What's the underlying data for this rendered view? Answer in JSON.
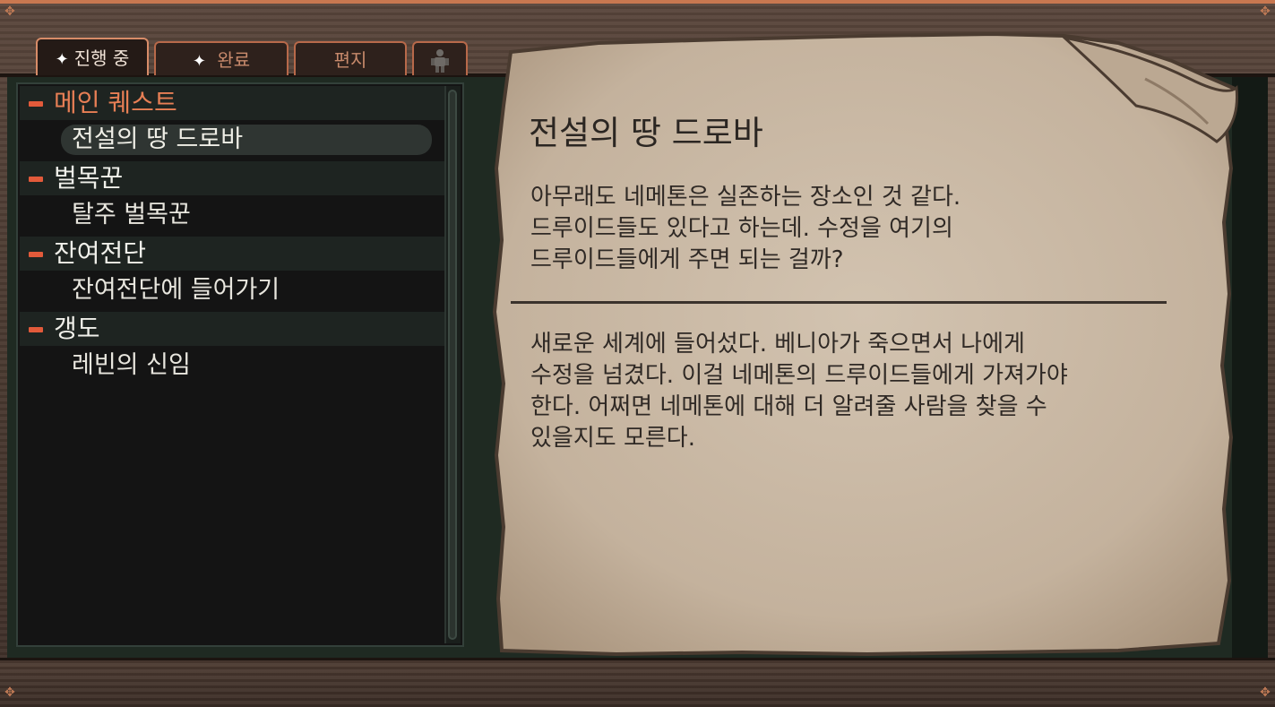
{
  "tabs": [
    {
      "label": "진행 중",
      "active": true,
      "has_spark": true
    },
    {
      "label": "완료",
      "active": false,
      "has_spark": true
    },
    {
      "label": "편지",
      "active": false,
      "has_spark": false
    },
    {
      "icon": "character-silhouette-icon",
      "active": false
    }
  ],
  "quest_list": {
    "categories": [
      {
        "label": "메인 퀘스트",
        "quests": [
          {
            "label": "전설의 땅 드로바",
            "selected": true
          }
        ]
      },
      {
        "label": "벌목꾼",
        "quests": [
          {
            "label": "탈주 벌목꾼",
            "selected": false
          }
        ]
      },
      {
        "label": "잔여전단",
        "quests": [
          {
            "label": "잔여전단에 들어가기",
            "selected": false
          }
        ]
      },
      {
        "label": "갱도",
        "quests": [
          {
            "label": "레빈의 신임",
            "selected": false
          }
        ]
      }
    ]
  },
  "detail": {
    "title": "전설의 땅 드로바",
    "objective_lines": [
      "아무래도 네메톤은 실존하는 장소인 것 같다.",
      "드루이드들도 있다고 하는데. 수정을 여기의",
      "드루이드들에게 주면 되는 걸까?"
    ],
    "description_lines": [
      "새로운 세계에 들어섰다. 베니아가 죽으면서 나에게",
      "수정을 넘겼다. 이걸 네메톤의 드루이드들에게 가져가야",
      "한다. 어쩌면 네메톤에 대해 더 알려줄 사람을 찾을 수",
      "있을지도 모른다."
    ]
  },
  "colors": {
    "accent_orange": "#e87f55",
    "minus_red": "#e25a3a",
    "tab_border": "#b8694a",
    "parchment": "#c8b8a4",
    "ink": "#2b2622"
  }
}
